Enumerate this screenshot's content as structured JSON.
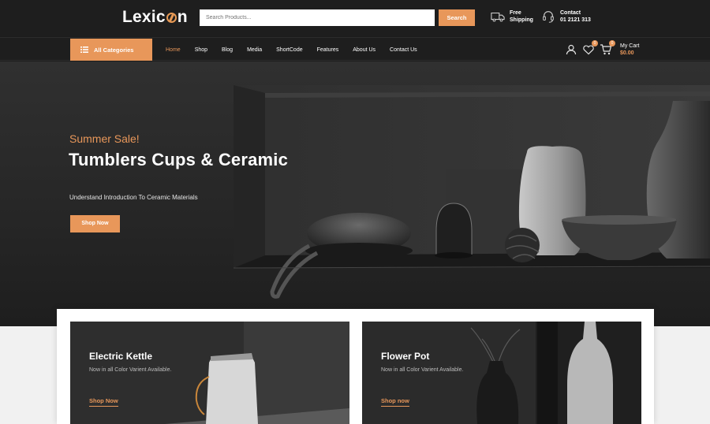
{
  "header": {
    "logo": "Lexic",
    "logo_tail": "n",
    "search_placeholder": "Search Products...",
    "search_button": "Search",
    "shipping_line1": "Free",
    "shipping_line2": "Shipping",
    "contact_line1": "Contact",
    "contact_line2": "01 2121 313"
  },
  "nav": {
    "all_categories": "All Categories",
    "items": [
      "Home",
      "Shop",
      "Blog",
      "Media",
      "ShortCode",
      "Features",
      "About Us",
      "Contact Us"
    ],
    "active_item": "Home",
    "wishlist_count": "0",
    "cart_count": "0",
    "cart_label": "My Cart",
    "cart_amount": "$0.00"
  },
  "hero": {
    "subtitle": "Summer Sale!",
    "title": "Tumblers Cups & Ceramic",
    "description": "Understand Introduction To Ceramic Materials",
    "button": "Shop Now"
  },
  "promos": [
    {
      "title": "Electric Kettle",
      "description": "Now in all Color Varient Available.",
      "link": "Shop Now"
    },
    {
      "title": "Flower Pot",
      "description": "Now in all Color Varient Available.",
      "link": "Shop now"
    }
  ],
  "colors": {
    "accent": "#e8975a",
    "header_bg": "#1e1e1e",
    "hero_bg": "#2a2a2a"
  },
  "icons": {
    "shipping": "truck-icon",
    "contact": "headset-icon",
    "categories": "list-icon",
    "account": "user-icon",
    "wishlist": "heart-icon",
    "cart": "cart-icon"
  }
}
